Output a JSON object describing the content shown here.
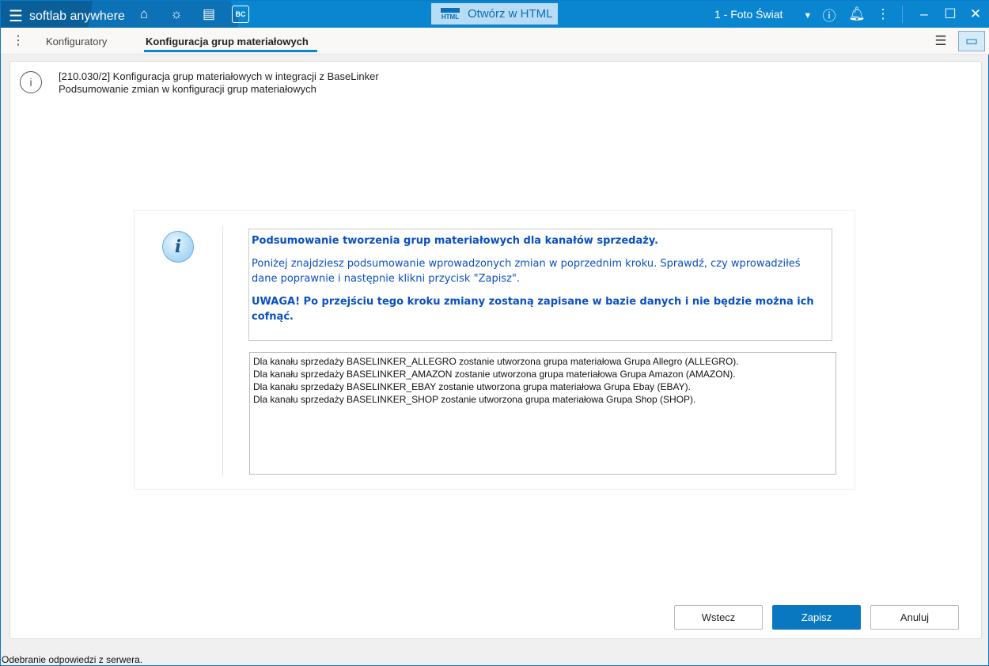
{
  "app": {
    "name": "softlab anywhere",
    "open_html": "Otwórz w HTML",
    "html_badge": "HTML",
    "company": "1 - Foto Świat"
  },
  "tabs": [
    {
      "label": "Konfiguratory"
    },
    {
      "label": "Konfiguracja grup materiałowych"
    }
  ],
  "header": {
    "line1": "[210.030/2] Konfiguracja grup materiałowych w integracji z BaseLinker",
    "line2": "Podsumowanie zmian w konfiguracji grup materiałowych"
  },
  "message": {
    "title": "Podsumowanie tworzenia grup materiałowych dla kanałów sprzedaży.",
    "body": "Poniżej znajdziesz podsumowanie wprowadzonych zmian w poprzednim kroku. Sprawdź, czy wprowadziłeś dane poprawnie i następnie klikni przycisk \"Zapisz\".",
    "warning": "UWAGA! Po przejściu tego kroku zmiany zostaną zapisane w bazie danych i nie będzie można ich cofnąć."
  },
  "summary": [
    "Dla kanału sprzedaży BASELINKER_ALLEGRO zostanie utworzona grupa materiałowa Grupa Allegro (ALLEGRO).",
    "Dla kanału sprzedaży BASELINKER_AMAZON zostanie utworzona grupa materiałowa Grupa Amazon (AMAZON).",
    "Dla kanału sprzedaży BASELINKER_EBAY zostanie utworzona grupa materiałowa Grupa Ebay (EBAY).",
    "Dla kanału sprzedaży BASELINKER_SHOP zostanie utworzona grupa materiałowa Grupa Shop (SHOP)."
  ],
  "buttons": {
    "back": "Wstecz",
    "save": "Zapisz",
    "cancel": "Anuluj"
  },
  "status": "Odebranie odpowiedzi z serwera."
}
